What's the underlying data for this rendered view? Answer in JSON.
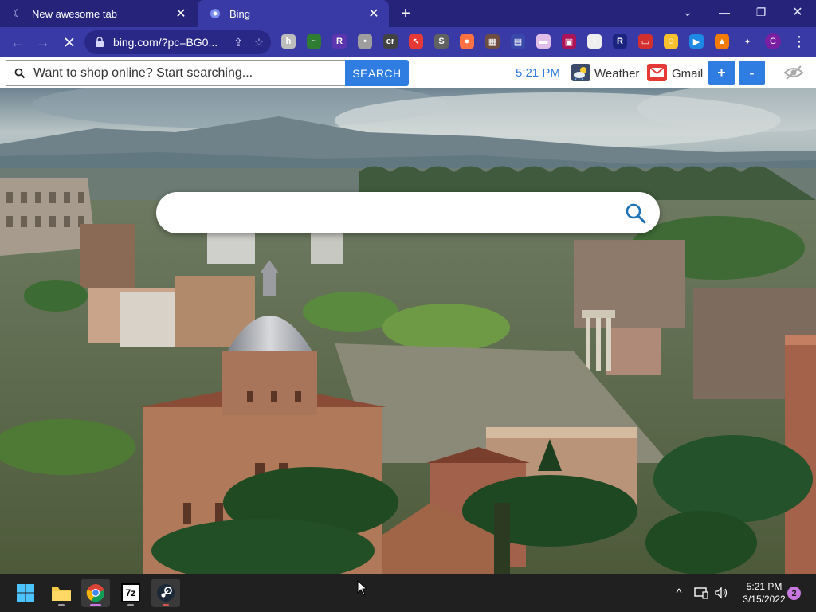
{
  "browser": {
    "tabs": [
      {
        "title": "New awesome tab",
        "favicon": "moon-icon",
        "active": false
      },
      {
        "title": "Bing",
        "favicon": "bing-icon",
        "active": true
      }
    ],
    "new_tab_symbol": "+",
    "url": "bing.com/?pc=BG0...",
    "profile_initial": "C",
    "extensions": [
      {
        "name": "ext-gray-icon",
        "color": "#bdbdbd",
        "glyph": "h"
      },
      {
        "name": "ext-feather-icon",
        "color": "#2e7d32",
        "glyph": "~"
      },
      {
        "name": "ext-r-purple-icon",
        "color": "#5e35b1",
        "glyph": "R"
      },
      {
        "name": "ext-speech-icon",
        "color": "#9e9e9e",
        "glyph": "•"
      },
      {
        "name": "ext-cr-icon",
        "color": "#424242",
        "glyph": "cr"
      },
      {
        "name": "ext-cursor-icon",
        "color": "#e53935",
        "glyph": "↖"
      },
      {
        "name": "ext-s-icon",
        "color": "#616161",
        "glyph": "S"
      },
      {
        "name": "ext-color-icon",
        "color": "#ff7043",
        "glyph": "●"
      },
      {
        "name": "ext-grid-icon",
        "color": "#6d4c41",
        "glyph": "▦"
      },
      {
        "name": "ext-calendar-icon",
        "color": "#3949ab",
        "glyph": "▤"
      },
      {
        "name": "ext-flag-icon",
        "color": "#e1bee7",
        "glyph": "▬"
      },
      {
        "name": "ext-red-square-icon",
        "color": "#ad1457",
        "glyph": "▣"
      },
      {
        "name": "ext-music-icon",
        "color": "#eeeeee",
        "glyph": "♪"
      },
      {
        "name": "ext-r-blue-icon",
        "color": "#1a237e",
        "glyph": "R"
      },
      {
        "name": "ext-card-icon",
        "color": "#d32f2f",
        "glyph": "▭"
      },
      {
        "name": "ext-face-icon",
        "color": "#fbc02d",
        "glyph": "☺"
      },
      {
        "name": "ext-play-icon",
        "color": "#1e88e5",
        "glyph": "▶"
      },
      {
        "name": "ext-hat-icon",
        "color": "#f57c00",
        "glyph": "▲"
      },
      {
        "name": "ext-puzzle-icon",
        "color": "#3a3aa6",
        "glyph": "✦"
      }
    ]
  },
  "toolbar": {
    "shop_text": "Want to shop online? Start searching...",
    "search_label": "SEARCH",
    "time": "5:21 PM",
    "weather_label": "Weather",
    "gmail_label": "Gmail",
    "plus_label": "+",
    "minus_label": "-"
  },
  "page": {
    "search_placeholder": ""
  },
  "taskbar": {
    "apps": [
      {
        "name": "windows-start-icon"
      },
      {
        "name": "file-explorer-icon"
      },
      {
        "name": "chrome-icon"
      },
      {
        "name": "7zip-icon",
        "label": "7z"
      },
      {
        "name": "steam-icon"
      }
    ],
    "time": "5:21 PM",
    "date": "3/15/2022",
    "notifications": "2"
  },
  "colors": {
    "tabstrip": "#25237a",
    "active_tab": "#3a3aa6",
    "accent_blue": "#2f7de0",
    "taskbar": "#202020"
  }
}
